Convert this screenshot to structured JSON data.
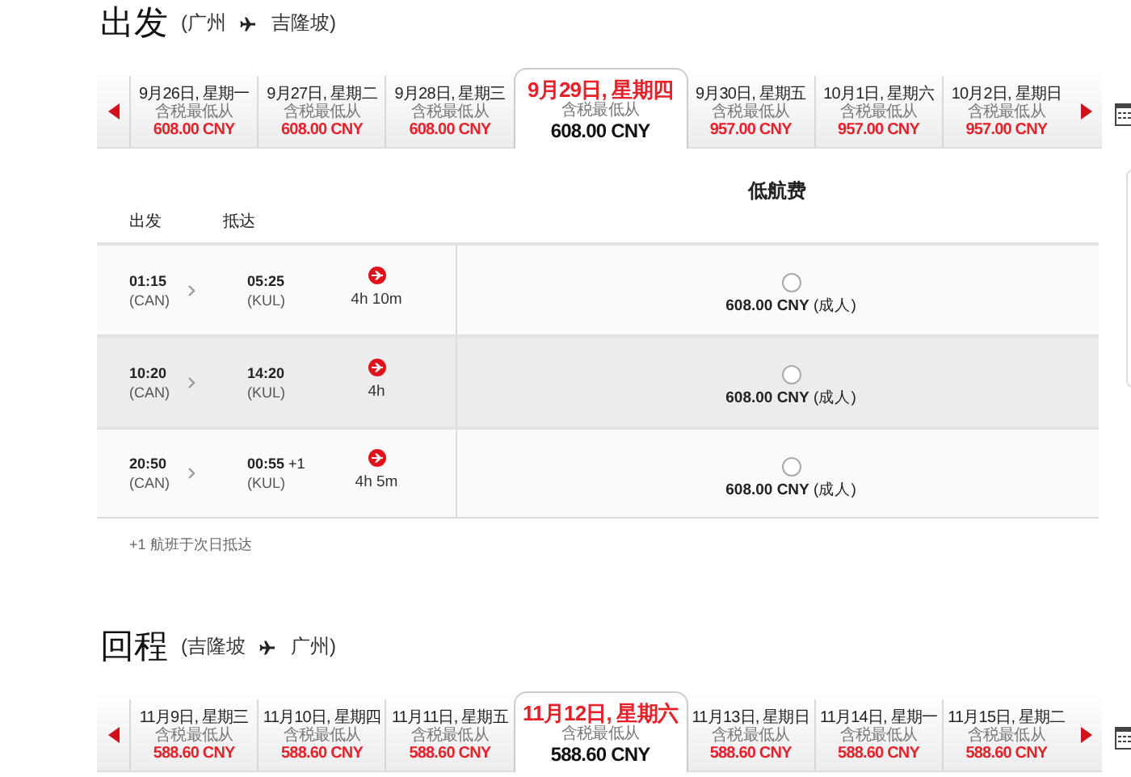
{
  "outbound": {
    "heading": "出发",
    "from": "(广州",
    "to": "吉隆坡)",
    "dates": [
      {
        "date": "9月26日, 星期一",
        "note": "含税最低从",
        "price": "608.00 CNY",
        "selected": false
      },
      {
        "date": "9月27日, 星期二",
        "note": "含税最低从",
        "price": "608.00 CNY",
        "selected": false
      },
      {
        "date": "9月28日, 星期三",
        "note": "含税最低从",
        "price": "608.00 CNY",
        "selected": false
      },
      {
        "date": "9月29日, 星期四",
        "note": "含税最低从",
        "price": "608.00 CNY",
        "selected": true
      },
      {
        "date": "9月30日, 星期五",
        "note": "含税最低从",
        "price": "957.00 CNY",
        "selected": false
      },
      {
        "date": "10月1日, 星期六",
        "note": "含税最低从",
        "price": "957.00 CNY",
        "selected": false
      },
      {
        "date": "10月2日, 星期日",
        "note": "含税最低从",
        "price": "957.00 CNY",
        "selected": false
      }
    ],
    "table": {
      "depart_label": "出发",
      "arrive_label": "抵达",
      "fare_label": "低航费",
      "rows": [
        {
          "depart": "01:15",
          "depart_code": "(CAN)",
          "arrive": "05:25",
          "next_day": "",
          "arrive_code": "(KUL)",
          "duration": "4h 10m",
          "price": "608.00 CNY",
          "fare_note": "(成人)",
          "selected": false,
          "highlighted": false
        },
        {
          "depart": "10:20",
          "depart_code": "(CAN)",
          "arrive": "14:20",
          "next_day": "",
          "arrive_code": "(KUL)",
          "duration": "4h",
          "price": "608.00 CNY",
          "fare_note": "(成人)",
          "selected": false,
          "highlighted": true
        },
        {
          "depart": "20:50",
          "depart_code": "(CAN)",
          "arrive": "00:55",
          "next_day": "+1",
          "arrive_code": "(KUL)",
          "duration": "4h 5m",
          "price": "608.00 CNY",
          "fare_note": "(成人)",
          "selected": false,
          "highlighted": false
        }
      ]
    },
    "footnote": "+1 航班于次日抵达"
  },
  "return": {
    "heading": "回程",
    "from": "(吉隆坡",
    "to": "广州)",
    "dates": [
      {
        "date": "11月9日, 星期三",
        "note": "含税最低从",
        "price": "588.60 CNY",
        "selected": false
      },
      {
        "date": "11月10日, 星期四",
        "note": "含税最低从",
        "price": "588.60 CNY",
        "selected": false
      },
      {
        "date": "11月11日, 星期五",
        "note": "含税最低从",
        "price": "588.60 CNY",
        "selected": false
      },
      {
        "date": "11月12日, 星期六",
        "note": "含税最低从",
        "price": "588.60 CNY",
        "selected": true
      },
      {
        "date": "11月13日, 星期日",
        "note": "含税最低从",
        "price": "588.60 CNY",
        "selected": false
      },
      {
        "date": "11月14日, 星期一",
        "note": "含税最低从",
        "price": "588.60 CNY",
        "selected": false
      },
      {
        "date": "11月15日, 星期二",
        "note": "含税最低从",
        "price": "588.60 CNY",
        "selected": false
      }
    ]
  }
}
